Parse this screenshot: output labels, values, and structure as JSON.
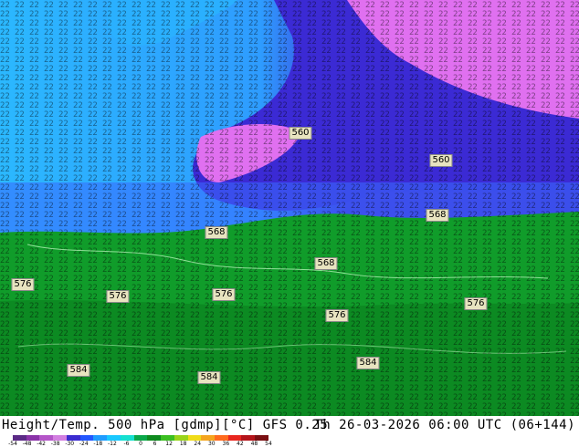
{
  "map": {
    "contour_labels": [
      "560",
      "560",
      "568",
      "568",
      "568",
      "576",
      "576",
      "576",
      "576",
      "576",
      "584",
      "584",
      "584"
    ]
  },
  "footer": {
    "title": "Height/Temp. 500 hPa [gdmp][°C] GFS 0.25",
    "datetime": "Th 26-03-2026 06:00 UTC (06+144)",
    "colorbar_ticks": [
      "-54",
      "-48",
      "-42",
      "-38",
      "-30",
      "-24",
      "-18",
      "-12",
      "-6",
      "0",
      "6",
      "12",
      "18",
      "24",
      "30",
      "36",
      "42",
      "48",
      "54"
    ],
    "colorbar_colors": [
      "#5b2a86",
      "#8a33a8",
      "#b455c8",
      "#d27fe0",
      "#3a2bd0",
      "#2357ff",
      "#1f9cff",
      "#19c8ff",
      "#15e0d0",
      "#0aa84a",
      "#0e8a1e",
      "#3bbf21",
      "#9ad41a",
      "#f0dc18",
      "#f5a51e",
      "#ff6a1e",
      "#e8261e",
      "#b4141a",
      "#7a0f12"
    ]
  }
}
